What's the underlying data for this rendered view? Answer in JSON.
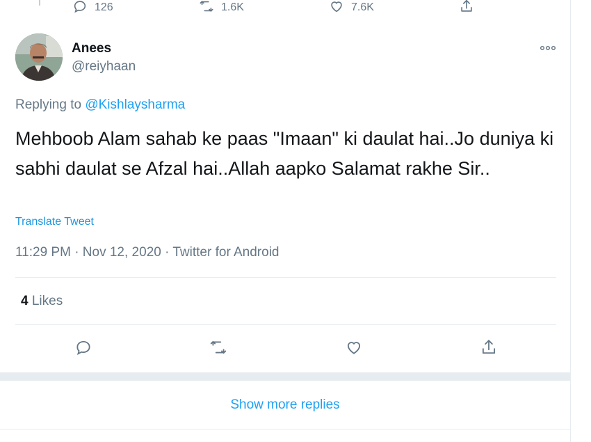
{
  "previous_tweet": {
    "actions": [
      {
        "icon": "reply-icon",
        "count": "126"
      },
      {
        "icon": "retweet-icon",
        "count": "1.6K"
      },
      {
        "icon": "like-icon",
        "count": "7.6K"
      },
      {
        "icon": "share-icon",
        "count": ""
      }
    ]
  },
  "tweet": {
    "user": {
      "name": "Anees",
      "handle": "@reiyhaan"
    },
    "replying_prefix": "Replying to",
    "replying_to": "@Kishlaysharma",
    "text": "Mehboob Alam sahab ke paas \"Imaan\" ki daulat hai..Jo duniya ki sabhi daulat se Afzal hai..Allah aapko Salamat rakhe Sir..",
    "translate_label": "Translate Tweet",
    "meta": "11:29 PM · Nov 12, 2020 · Twitter for Android",
    "likes_count": "4",
    "likes_label": "Likes"
  },
  "show_more_label": "Show more replies",
  "colors": {
    "accent": "#1da1f2",
    "link": "#1b95e0",
    "secondary_text": "#657786",
    "divider": "#e6ecf0"
  }
}
